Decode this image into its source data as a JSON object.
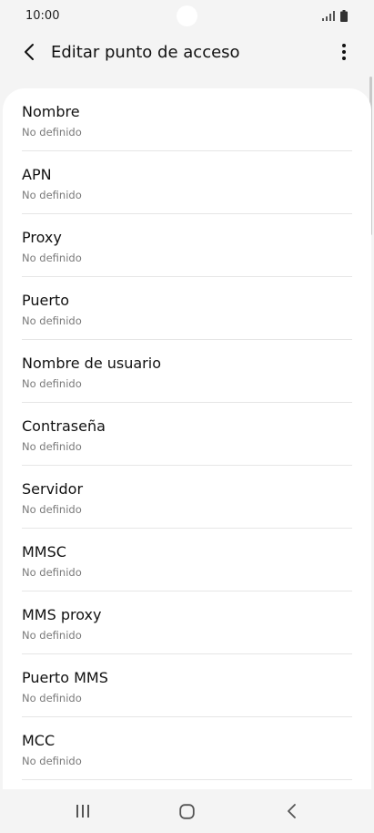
{
  "status_bar": {
    "time": "10:00",
    "icons": [
      "signal-icon",
      "battery-icon"
    ]
  },
  "app_bar": {
    "title": "Editar punto de acceso",
    "back_icon": "back-icon",
    "more_icon": "more-icon"
  },
  "fields": [
    {
      "label": "Nombre",
      "value": "No definido"
    },
    {
      "label": "APN",
      "value": "No definido"
    },
    {
      "label": "Proxy",
      "value": "No definido"
    },
    {
      "label": "Puerto",
      "value": "No definido"
    },
    {
      "label": "Nombre de usuario",
      "value": "No definido"
    },
    {
      "label": "Contraseña",
      "value": "No definido"
    },
    {
      "label": "Servidor",
      "value": "No definido"
    },
    {
      "label": "MMSC",
      "value": "No definido"
    },
    {
      "label": "MMS proxy",
      "value": "No definido"
    },
    {
      "label": "Puerto MMS",
      "value": "No definido"
    },
    {
      "label": "MCC",
      "value": "No definido"
    }
  ],
  "nav_bar": {
    "icons": [
      "recent-apps-icon",
      "home-icon",
      "nav-back-icon"
    ]
  },
  "colors": {
    "background": "#f4f4f4",
    "card": "#ffffff",
    "text_primary": "#111111",
    "text_secondary": "#7a7a7a",
    "divider": "#e6e6e6"
  }
}
